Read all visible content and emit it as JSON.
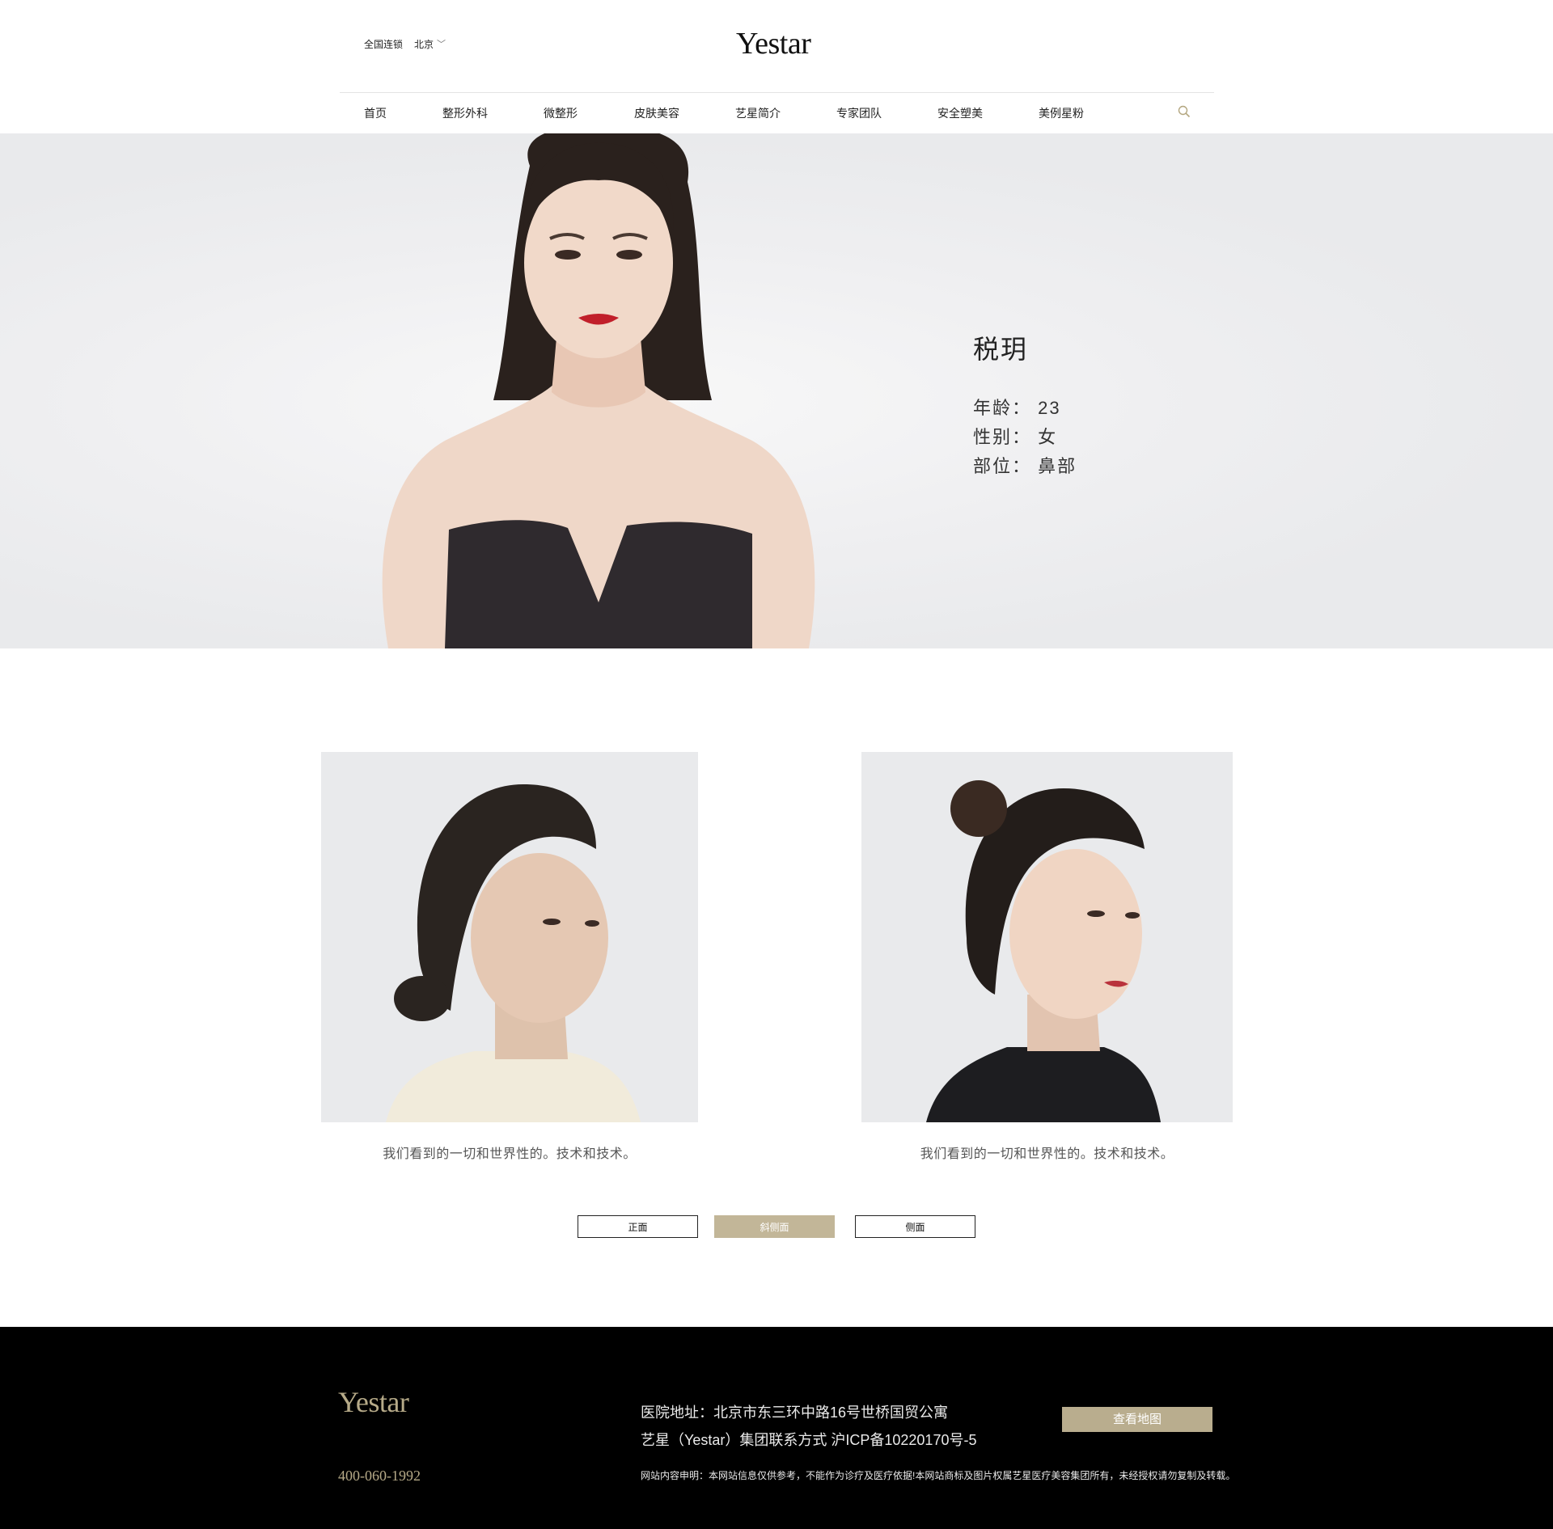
{
  "header": {
    "chain_label": "全国连锁",
    "city": "北京",
    "logo": "Yestar",
    "nav": [
      "首页",
      "整形外科",
      "微整形",
      "皮肤美容",
      "艺星简介",
      "专家团队",
      "安全塑美",
      "美例星粉"
    ]
  },
  "hero": {
    "name": "税玥",
    "age": "年龄：  23",
    "gender": "性别：  女",
    "area": "部位：  鼻部"
  },
  "comparison": {
    "captions": [
      "我们看到的一切和世界性的。技术和技术。",
      "我们看到的一切和世界性的。技术和技术。"
    ],
    "views": [
      "正面",
      "斜侧面",
      "侧面"
    ],
    "active_view": "斜侧面"
  },
  "footer": {
    "logo": "Yestar",
    "phone": "400-060-1992",
    "address": "医院地址：北京市东三环中路16号世桥国贸公寓",
    "contact": "艺星（Yestar）集团联系方式 沪ICP备10220170号-5",
    "note": "网站内容申明：本网站信息仅供参考，不能作为诊疗及医疗依据!本网站商标及图片权属艺星医疗美容集团所有，未经授权请勿复制及转载。",
    "map_button": "查看地图"
  },
  "colors": {
    "accent": "#c2b698",
    "footer_bg": "#000000",
    "hero_bg": "#edeef0"
  }
}
